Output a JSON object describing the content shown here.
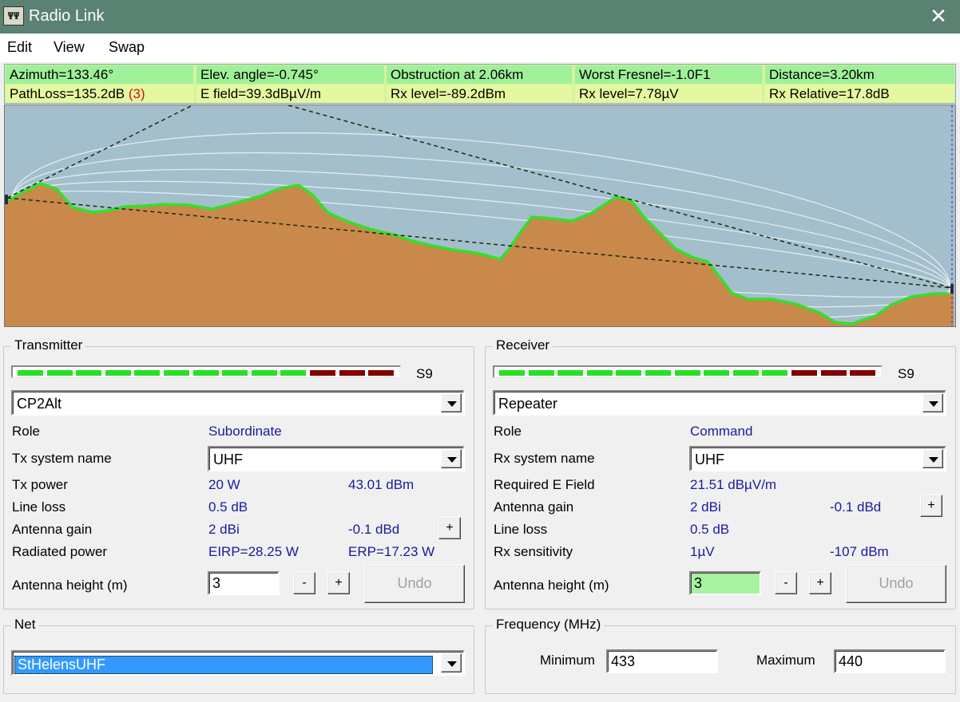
{
  "window": {
    "title": "Radio Link",
    "close_glyph": "✕",
    "icon_text": "ΨΨ"
  },
  "menu": {
    "edit": "Edit",
    "view": "View",
    "swap": "Swap"
  },
  "info": {
    "azimuth": "Azimuth=133.46°",
    "elev_angle": "Elev. angle=-0.745°",
    "obstruction": "Obstruction at 2.06km",
    "worst_fresnel": "Worst Fresnel=-1.0F1",
    "distance": "Distance=3.20km",
    "path_loss": "PathLoss=135.2dB ",
    "path_loss_count": "(3)",
    "e_field": "E field=39.3dBµV/m",
    "rx_level_dbm": "Rx level=-89.2dBm",
    "rx_level_uv": "Rx level=7.78µV",
    "rx_relative": "Rx Relative=17.8dB"
  },
  "colors": {
    "terrain": "#c9894a",
    "terrain_edge": "#33e02a",
    "sky": "#a4bfcc",
    "meter_green": "#28e028",
    "meter_red": "#800000"
  },
  "transmitter": {
    "group_label": "Transmitter",
    "meter_level": "S9",
    "meter_lit_segments": 10,
    "meter_total_segments": 13,
    "unit": "CP2Alt",
    "role_label": "Role",
    "role_value": "Subordinate",
    "system_label": "Tx system name",
    "system_value": "UHF",
    "power_label": "Tx power",
    "power_w": "20 W",
    "power_dbm": "43.01 dBm",
    "line_loss_label": "Line loss",
    "line_loss_value": "0.5 dB",
    "gain_label": "Antenna gain",
    "gain_dbi": "2 dBi",
    "gain_dbd": "-0.1 dBd",
    "radiated_label": "Radiated power",
    "eirp": "EIRP=28.25 W",
    "erp": "ERP=17.23 W",
    "height_label": "Antenna height (m)",
    "height_value": "3",
    "minus": "-",
    "plus": "+",
    "undo": "Undo"
  },
  "receiver": {
    "group_label": "Receiver",
    "meter_level": "S9",
    "meter_lit_segments": 10,
    "meter_total_segments": 13,
    "unit": "Repeater",
    "role_label": "Role",
    "role_value": "Command",
    "system_label": "Rx system name",
    "system_value": "UHF",
    "field_label": "Required E Field",
    "field_value": "21.51 dBµV/m",
    "gain_label": "Antenna gain",
    "gain_dbi": "2 dBi",
    "gain_dbd": "-0.1 dBd",
    "line_loss_label": "Line loss",
    "line_loss_value": "0.5 dB",
    "sens_label": "Rx sensitivity",
    "sens_uv": "1µV",
    "sens_dbm": "-107 dBm",
    "height_label": "Antenna height (m)",
    "height_value": "3",
    "minus": "-",
    "plus": "+",
    "undo": "Undo"
  },
  "net": {
    "group_label": "Net",
    "value": "StHelensUHF"
  },
  "frequency": {
    "group_label": "Frequency (MHz)",
    "min_label": "Minimum",
    "min_value": "433",
    "max_label": "Maximum",
    "max_value": "440"
  }
}
